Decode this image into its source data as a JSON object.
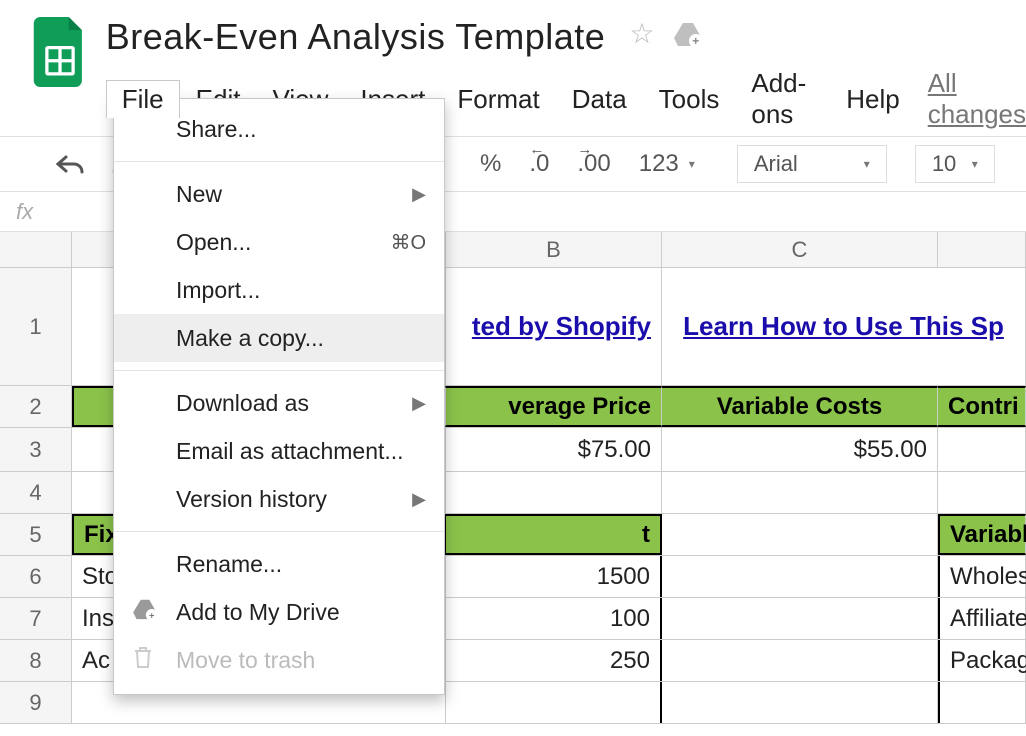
{
  "doc": {
    "title": "Break-Even Analysis Template",
    "saved": "All changes"
  },
  "menus": {
    "file": "File",
    "edit": "Edit",
    "view": "View",
    "insert": "Insert",
    "format": "Format",
    "data": "Data",
    "tools": "Tools",
    "addons": "Add-ons",
    "help": "Help"
  },
  "file_menu": {
    "share": "Share...",
    "new": "New",
    "open": "Open...",
    "open_kbd": "⌘O",
    "import": "Import...",
    "make_copy": "Make a copy...",
    "download_as": "Download as",
    "email_attach": "Email as attachment...",
    "version_history": "Version history",
    "rename": "Rename...",
    "add_drive": "Add to My Drive",
    "move_trash": "Move to trash"
  },
  "toolbar": {
    "percent": "%",
    "dec_less": ".0",
    "dec_more": ".00",
    "format123": "123",
    "font": "Arial",
    "size": "10"
  },
  "fx": "fx",
  "columns": {
    "B": "B",
    "C": "C"
  },
  "row_numbers": {
    "r1": "1",
    "r2": "2",
    "r3": "3",
    "r4": "4",
    "r5": "5",
    "r6": "6",
    "r7": "7",
    "r8": "8",
    "r9": "9"
  },
  "links": {
    "shopify": "ted by Shopify",
    "howto": "Learn How to Use This Sp"
  },
  "headers": {
    "fixed_costs": "Fix",
    "avg_price": "verage Price",
    "var_costs": "Variable Costs",
    "contrib": "Contri",
    "cost_col": "t",
    "variable": "Variable"
  },
  "values": {
    "price": "$75.00",
    "varcost": "$55.00",
    "r6a": "Sto",
    "r6b": "1500",
    "r6d": "Wholesa",
    "r7a": "Ins",
    "r7b": "100",
    "r7d": "Affiliate ",
    "r8a": "Ac",
    "r8b": "250",
    "r8d": "Packagi"
  }
}
